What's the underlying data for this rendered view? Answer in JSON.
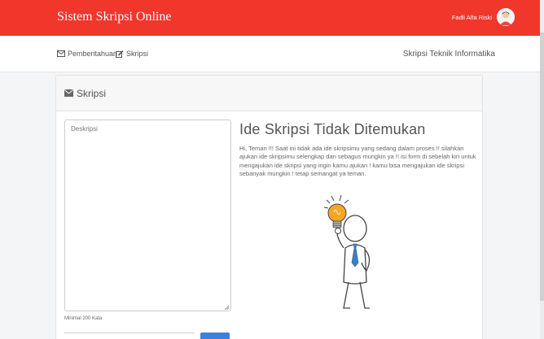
{
  "header": {
    "brand": "Sistem Skripsi Online",
    "user_name": "Fadli Alfa Riski"
  },
  "subnav": {
    "links": [
      {
        "label": "Pemberitahuan",
        "icon": "envelope-icon"
      },
      {
        "label": "Skripsi",
        "icon": "edit-icon"
      }
    ],
    "program": "Skripsi Teknik Informatika"
  },
  "card": {
    "title": "Skripsi",
    "title_icon": "envelope-icon",
    "textarea_placeholder": "Deskripsi",
    "hint": "Minimal 200 Kata",
    "notice_title": "Ide Skripsi Tidak Ditemukan",
    "notice_text": "Hi, Teman !!! Saat ini tidak ada ide skripsimu yang sedang dalam proses !! silahkan ajukan ide skripsimu selengkap dan sebagus mungkin ya !! isi form di sebelah kiri untuk mengajukan ide skripsi yang ingin kamu ajukan ! kamu bisa mengajukan ide skripsi sebanyak mungkin ! tetap semangat ya teman."
  },
  "colors": {
    "brand_red": "#f1362c",
    "button_blue": "#3b82e0",
    "bulb_orange": "#f6a623"
  }
}
